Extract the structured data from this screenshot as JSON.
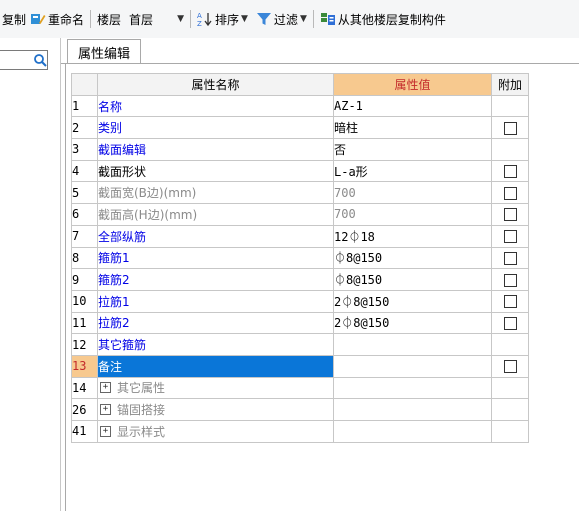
{
  "toolbar": {
    "copy_label": "复制",
    "rename_label": "重命名",
    "floor_label": "楼层",
    "floor_value": "首层",
    "sort_label": "排序",
    "filter_label": "过滤",
    "copy_from_floor_label": "从其他楼层复制构件"
  },
  "tab": {
    "label": "属性编辑"
  },
  "grid": {
    "headers": {
      "name": "属性名称",
      "value": "属性值",
      "extra": "附加"
    },
    "rows": [
      {
        "num": "1",
        "name": "名称",
        "value": "AZ-1",
        "checkbox": false
      },
      {
        "num": "2",
        "name": "类别",
        "value": "暗柱",
        "checkbox": true
      },
      {
        "num": "3",
        "name": "截面编辑",
        "value": "否",
        "checkbox": false
      },
      {
        "num": "4",
        "name": "截面形状",
        "value": "L-a形",
        "checkbox": true
      },
      {
        "num": "5",
        "name": "截面宽(B边)(mm)",
        "value": "700",
        "checkbox": true
      },
      {
        "num": "6",
        "name": "截面高(H边)(mm)",
        "value": "700",
        "checkbox": true
      },
      {
        "num": "7",
        "name": "全部纵筋",
        "value": "12⏀18",
        "checkbox": true
      },
      {
        "num": "8",
        "name": "箍筋1",
        "value": "⏀8@150",
        "checkbox": true
      },
      {
        "num": "9",
        "name": "箍筋2",
        "value": "⏀8@150",
        "checkbox": true
      },
      {
        "num": "10",
        "name": "拉筋1",
        "value": "2⏀8@150",
        "checkbox": true
      },
      {
        "num": "11",
        "name": "拉筋2",
        "value": "2⏀8@150",
        "checkbox": true
      },
      {
        "num": "12",
        "name": "其它箍筋",
        "value": "",
        "checkbox": false
      },
      {
        "num": "13",
        "name": "备注",
        "value": "",
        "checkbox": true
      }
    ],
    "groups": [
      {
        "num": "14",
        "name": "其它属性"
      },
      {
        "num": "26",
        "name": "锚固搭接"
      },
      {
        "num": "41",
        "name": "显示样式"
      }
    ]
  },
  "icons": [
    "rename-icon",
    "sort-icon",
    "filter-icon",
    "copy-floor-icon",
    "search-icon",
    "checkbox-icon",
    "expand-plus-icon"
  ]
}
